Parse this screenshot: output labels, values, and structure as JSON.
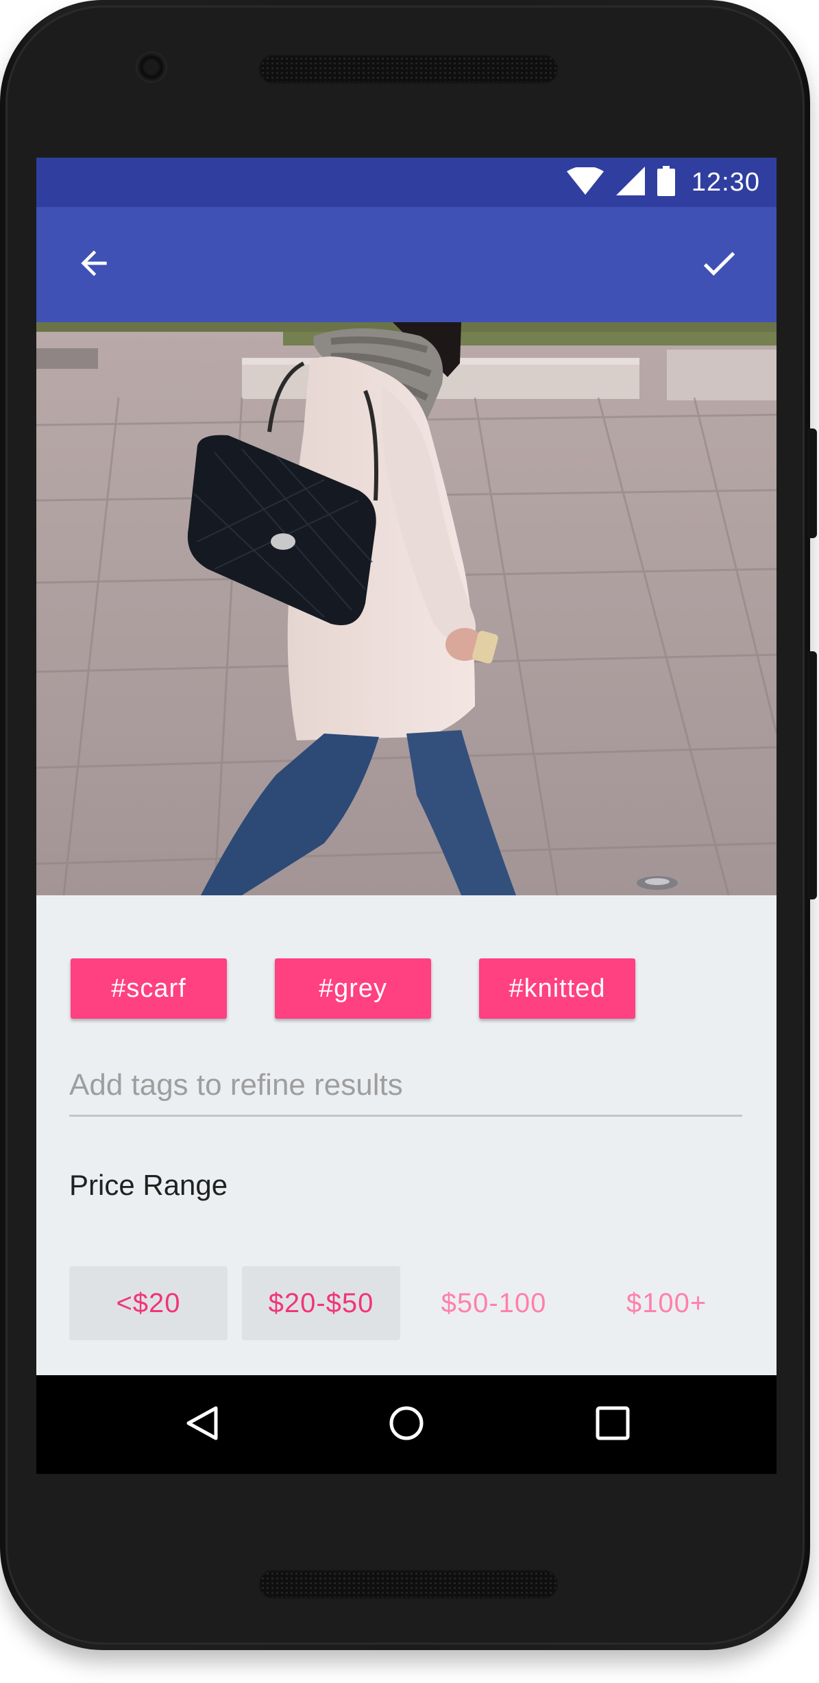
{
  "status_bar": {
    "time": "12:30",
    "icons": [
      "wifi-icon",
      "signal-icon",
      "battery-icon"
    ]
  },
  "app_bar": {
    "back_icon": "arrow-back-icon",
    "confirm_icon": "check-icon",
    "background": "#3f51b5",
    "status_background": "#303f9f"
  },
  "photo": {
    "subject": "woman-walking-photo"
  },
  "tags": {
    "items": [
      "#scarf",
      "#grey",
      "#knitted"
    ],
    "input_placeholder": "Add tags to refine results",
    "chip_color": "#ff4081"
  },
  "price_range": {
    "title": "Price Range",
    "options": [
      {
        "label": "<$20",
        "selected": true
      },
      {
        "label": "$20-$50",
        "selected": true
      },
      {
        "label": "$50-100",
        "selected": false
      },
      {
        "label": "$100+",
        "selected": false
      }
    ]
  },
  "nav_bar": {
    "icons": [
      "nav-back-icon",
      "nav-home-icon",
      "nav-recents-icon"
    ]
  }
}
